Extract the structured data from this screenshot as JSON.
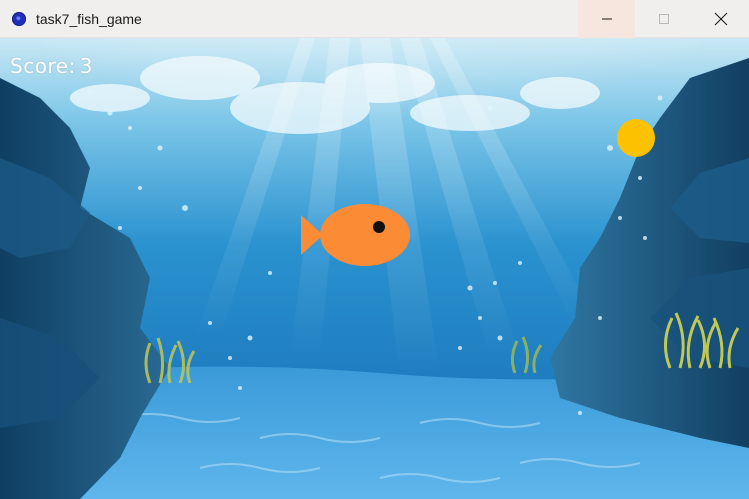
{
  "window": {
    "title": "task7_fish_game",
    "icon": "python-app-icon",
    "controls": [
      "minimize",
      "maximize",
      "close"
    ]
  },
  "hud": {
    "score_label": "Score:",
    "score_value": "3"
  },
  "colors": {
    "fish_body": "#fb8c35",
    "fish_eye": "#111111",
    "coin": "#fcc100",
    "water_top": "#bfe3f2",
    "water_mid": "#2a92cf",
    "water_bottom": "#1b6fb1"
  },
  "game_objects": [
    {
      "type": "player-fish",
      "color": "#fb8c35"
    },
    {
      "type": "food-coin",
      "color": "#fcc100"
    }
  ]
}
